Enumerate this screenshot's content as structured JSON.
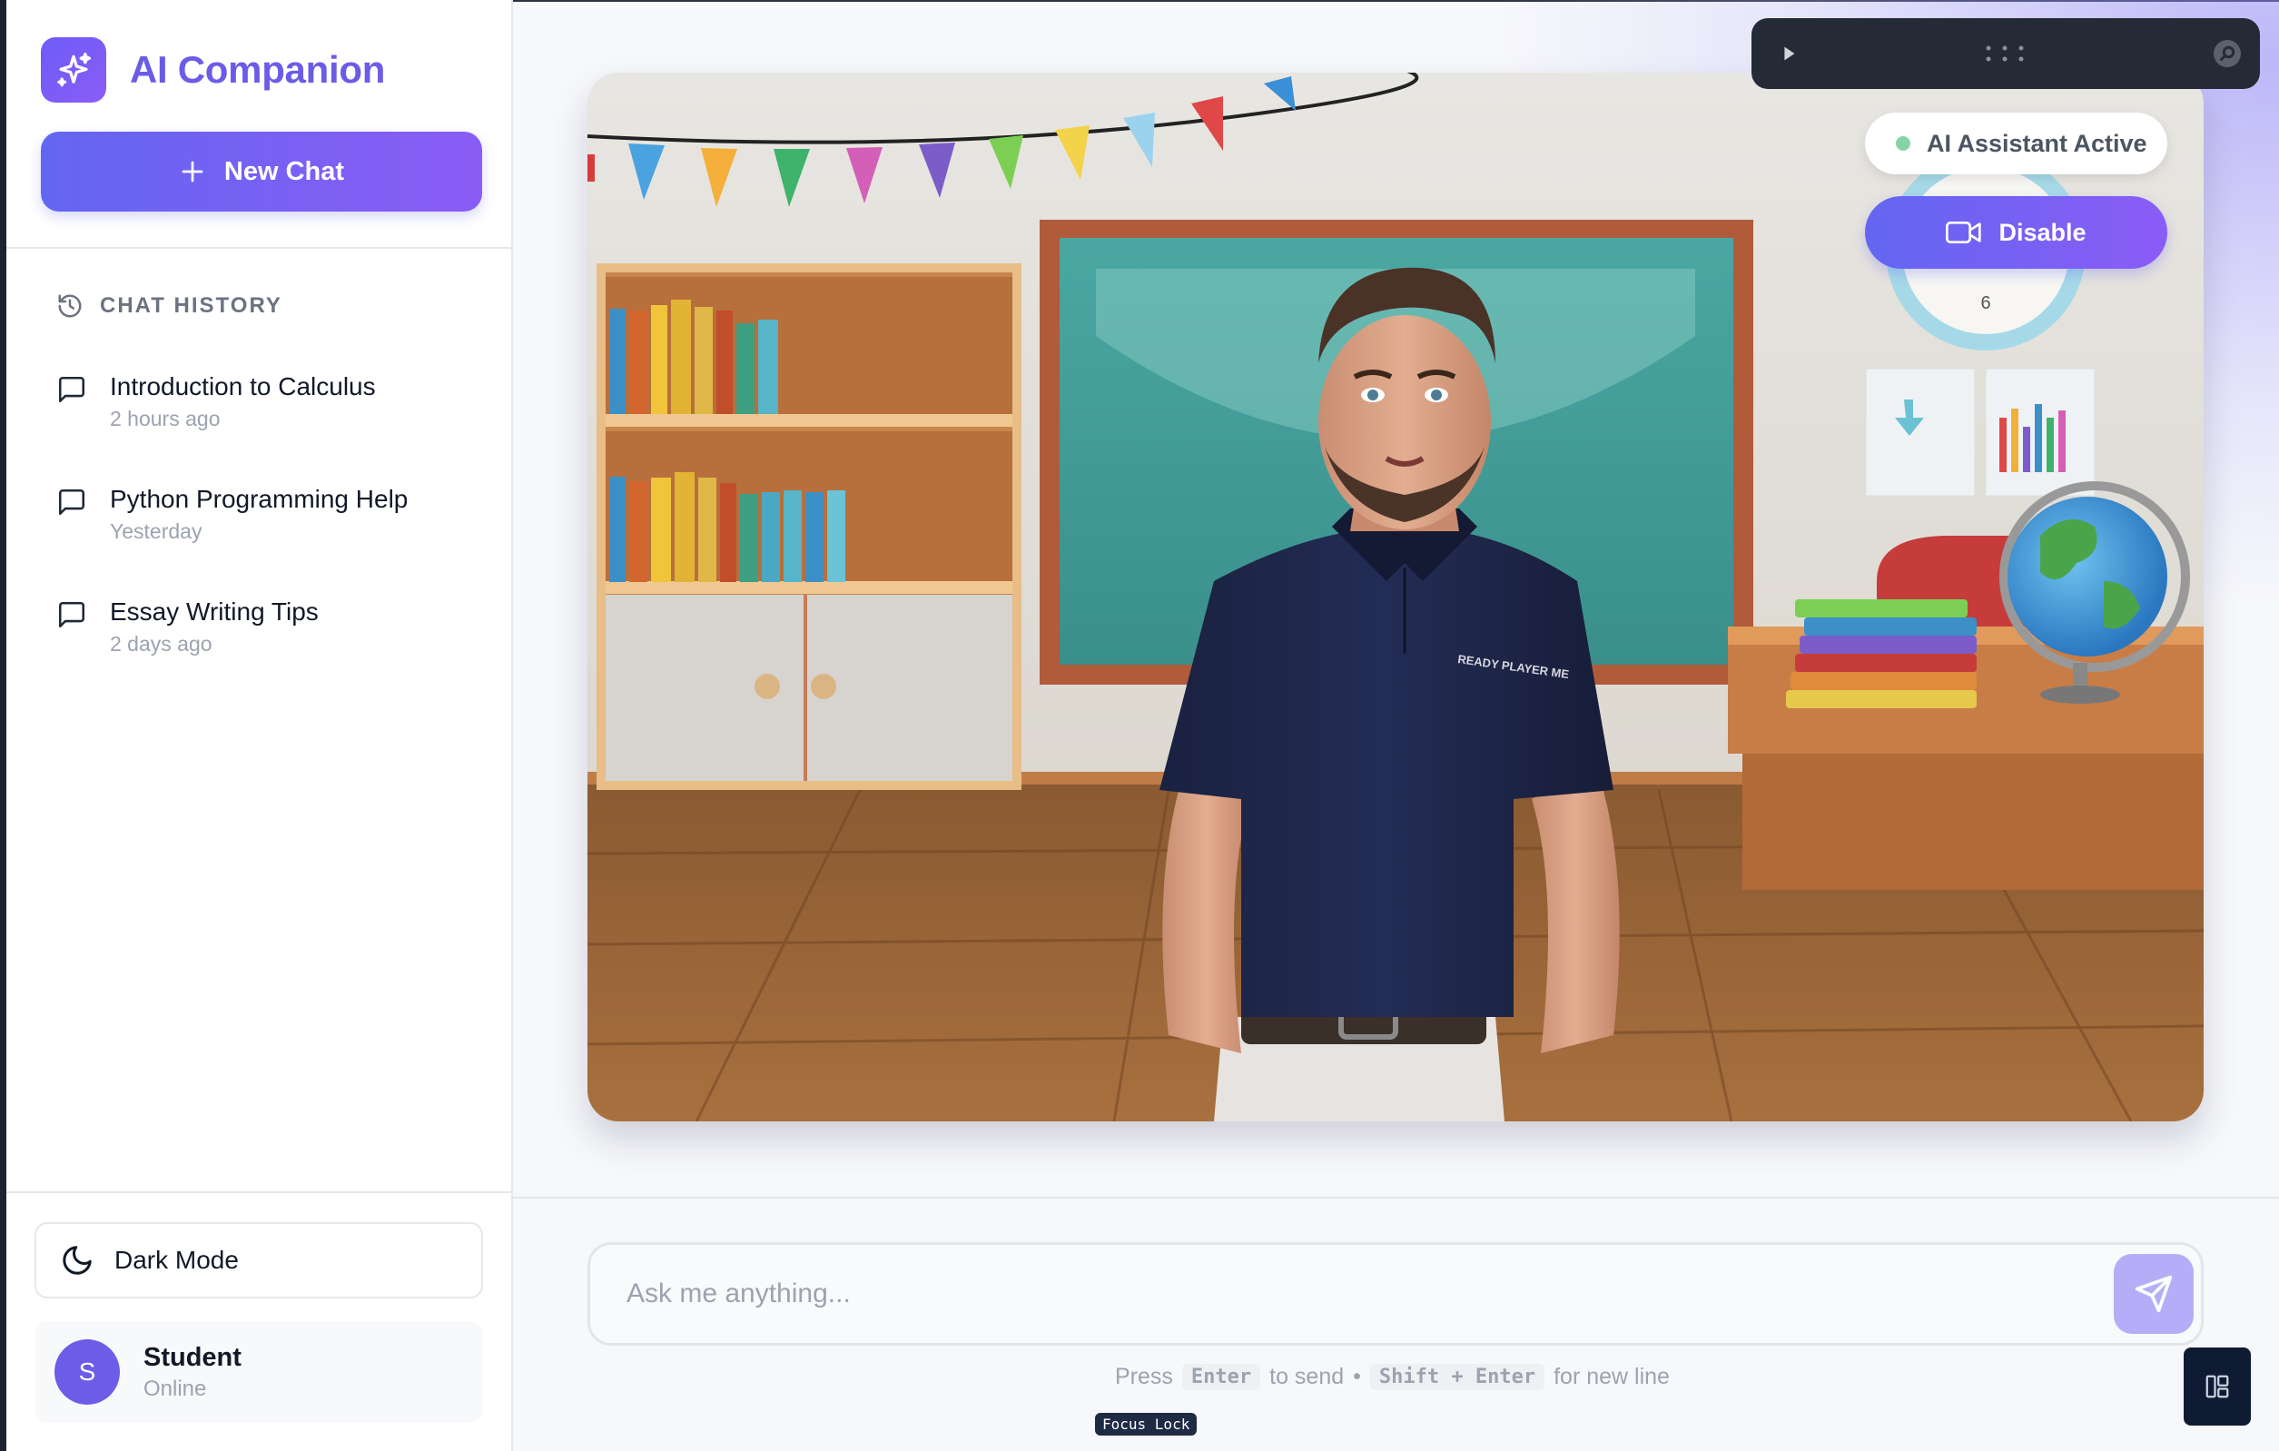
{
  "app": {
    "title": "AI Companion"
  },
  "sidebar": {
    "new_chat_label": "New Chat",
    "history_heading": "CHAT HISTORY",
    "history": [
      {
        "title": "Introduction to Calculus",
        "time": "2 hours ago"
      },
      {
        "title": "Python Programming Help",
        "time": "Yesterday"
      },
      {
        "title": "Essay Writing Tips",
        "time": "2 days ago"
      }
    ],
    "dark_mode_label": "Dark Mode",
    "user": {
      "initial": "S",
      "name": "Student",
      "status": "Online"
    }
  },
  "avatar_panel": {
    "status_label": "AI Assistant Active",
    "status_color": "#86d3a8",
    "disable_label": "Disable",
    "shirt_logo": "READY PLAYER ME"
  },
  "composer": {
    "placeholder": "Ask me anything...",
    "hint_press": "Press",
    "hint_key_send": "Enter",
    "hint_to_send": "to send",
    "hint_sep": "•",
    "hint_key_newline": "Shift + Enter",
    "hint_for_newline": "for new line",
    "focus_lock": "Focus Lock"
  },
  "colors": {
    "accent": "#6366f1",
    "accent_2": "#8b5cf6",
    "brand_text": "#6b5ce7"
  }
}
